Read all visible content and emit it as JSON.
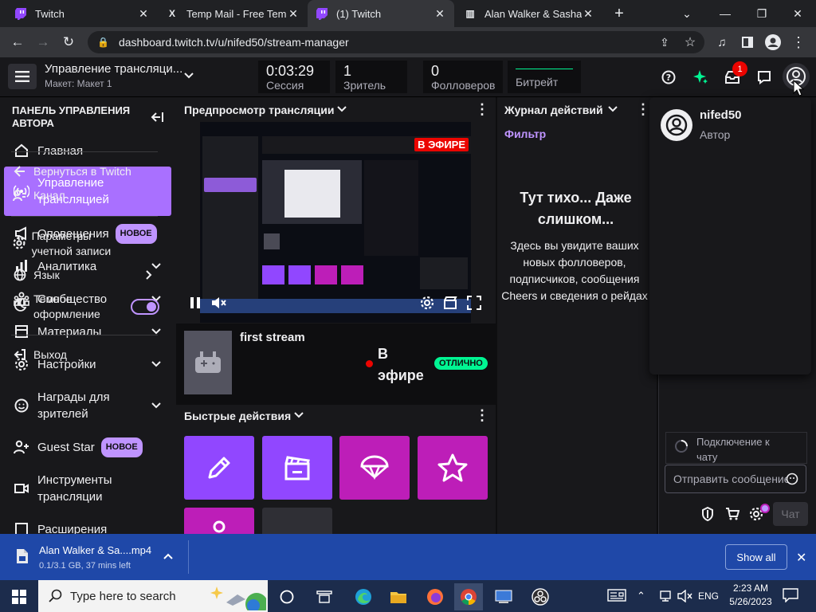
{
  "browser": {
    "tabs": [
      {
        "title": "Twitch",
        "icon": "twitch-icon"
      },
      {
        "title": "Temp Mail - Free Temp",
        "icon": "x-icon"
      },
      {
        "title": "(1) Twitch",
        "icon": "twitch-icon"
      },
      {
        "title": "Alan Walker & Sasha A",
        "icon": "columns-icon"
      }
    ],
    "url": "dashboard.twitch.tv/u/nifed50/stream-manager"
  },
  "header": {
    "title": "Управление трансляци...",
    "subtitle": "Макет: Макет 1",
    "stats": [
      {
        "value": "0:03:29",
        "label": "Сессия"
      },
      {
        "value": "1",
        "label": "Зритель"
      },
      {
        "value": "0",
        "label": "Фолловеров"
      },
      {
        "value": "",
        "label": "Битрейт"
      }
    ],
    "notification_count": "1"
  },
  "sidebar": {
    "title": "ПАНЕЛЬ УПРАВЛЕНИЯ АВТОРА",
    "items": [
      {
        "label": "Главная",
        "icon": "home-icon"
      },
      {
        "label": "Управление трансляцией",
        "icon": "broadcast-icon",
        "active": true
      },
      {
        "label": "Оповещения",
        "icon": "megaphone-icon",
        "badge": "НОВОЕ"
      },
      {
        "label": "Аналитика",
        "icon": "analytics-icon"
      },
      {
        "label": "Сообщество",
        "icon": "community-icon"
      },
      {
        "label": "Материалы",
        "icon": "content-icon"
      },
      {
        "label": "Настройки",
        "icon": "settings-icon"
      },
      {
        "label": "Награды для зрителей",
        "icon": "rewards-icon"
      },
      {
        "label": "Guest Star",
        "icon": "guest-star-icon",
        "badge": "НОВОЕ"
      },
      {
        "label": "Инструменты трансляции",
        "icon": "tools-icon"
      },
      {
        "label": "Расширения",
        "icon": "extensions-icon"
      }
    ]
  },
  "preview": {
    "title": "Предпросмотр трансляции",
    "live_badge": "В ЭФИРЕ",
    "stream_title": "first stream",
    "live_text": "В эфире",
    "health_badge": "ОТЛИЧНО"
  },
  "quick_actions": {
    "title": "Быстрые действия"
  },
  "activity": {
    "title": "Журнал действий",
    "filter": "Фильтр",
    "empty_title": "Тут тихо... Даже слишком...",
    "empty_body": "Здесь вы увидите ваших новых фолловеров, подписчиков, сообщения Cheers и сведения о рейдах"
  },
  "chat": {
    "connecting": "Подключение к чату",
    "placeholder": "Отправить сообщение",
    "send_label": "Чат"
  },
  "user_menu": {
    "username": "nifed50",
    "role": "Автор",
    "items": [
      {
        "label": "Вернуться в Twitch"
      },
      {
        "label": "Канал"
      },
      {
        "label": "Параметры учетной записи"
      },
      {
        "label": "Язык"
      },
      {
        "label": "Темное оформление"
      },
      {
        "label": "Выход"
      }
    ],
    "dark_mode_on": true
  },
  "download": {
    "filename": "Alan Walker & Sa....mp4",
    "status": "0.1/3.1 GB, 37 mins left",
    "show_all": "Show all"
  },
  "taskbar": {
    "search_placeholder": "Type here to search",
    "language": "ENG",
    "time": "2:23 AM",
    "date": "5/26/2023"
  },
  "colors": {
    "accent": "#9147ff",
    "accent_light": "#bf94ff",
    "tile_purple": "#9147ff",
    "tile_magenta": "#bd1eb8",
    "live_red": "#eb0400",
    "health_green": "#00f593"
  }
}
